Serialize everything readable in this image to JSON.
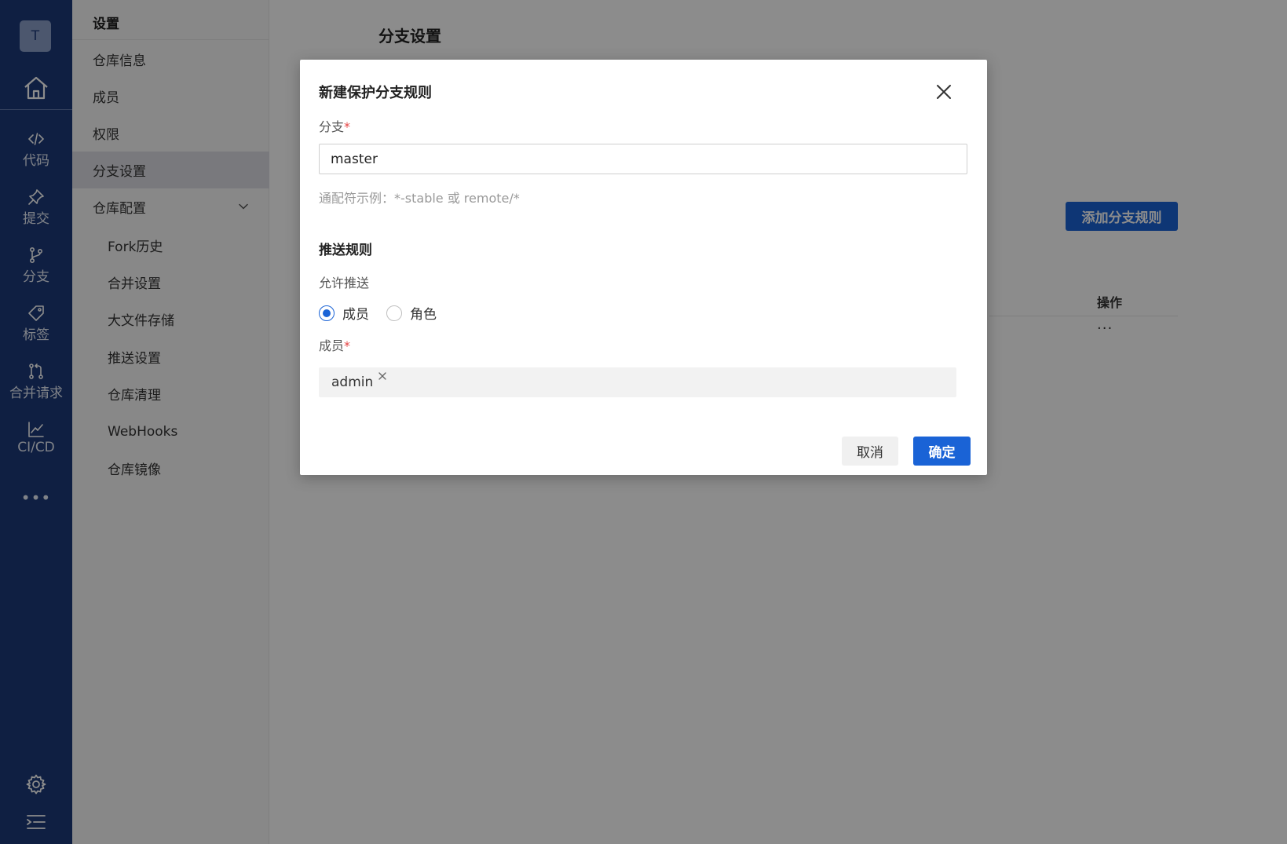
{
  "rail": {
    "avatar_letter": "T",
    "items": [
      {
        "label": "代码",
        "icon": "code-icon"
      },
      {
        "label": "提交",
        "icon": "pin-icon"
      },
      {
        "label": "分支",
        "icon": "branch-icon"
      },
      {
        "label": "标签",
        "icon": "tag-icon"
      },
      {
        "label": "合并请求",
        "icon": "merge-request-icon"
      },
      {
        "label": "CI/CD",
        "icon": "chart-line-icon"
      }
    ],
    "more": "•••"
  },
  "submenu": {
    "heading": "设置",
    "items": [
      {
        "label": "仓库信息"
      },
      {
        "label": "成员"
      },
      {
        "label": "权限"
      },
      {
        "label": "分支设置"
      },
      {
        "label": "仓库配置"
      },
      {
        "label": "Fork历史"
      },
      {
        "label": "合并设置"
      },
      {
        "label": "大文件存储"
      },
      {
        "label": "推送设置"
      },
      {
        "label": "仓库清理"
      },
      {
        "label": "WebHooks"
      },
      {
        "label": "仓库镜像"
      }
    ]
  },
  "main": {
    "page_title": "分支设置",
    "add_button": "添加分支规则",
    "col_ops": "操作",
    "row_more": "···"
  },
  "dialog": {
    "title": "新建保护分支规则",
    "branch_label": "分支",
    "required_mark": "*",
    "branch_value": "master",
    "hint": "通配符示例：*-stable 或 remote/*",
    "section_title": "推送规则",
    "allow_push_label": "允许推送",
    "radio_member": "成员",
    "radio_role": "角色",
    "members_label": "成员",
    "member_tag": "admin",
    "cancel": "取消",
    "ok": "确定"
  },
  "colors": {
    "rail_bg": "#1d3a78",
    "primary": "#1a63d6",
    "required": "#e54545"
  }
}
